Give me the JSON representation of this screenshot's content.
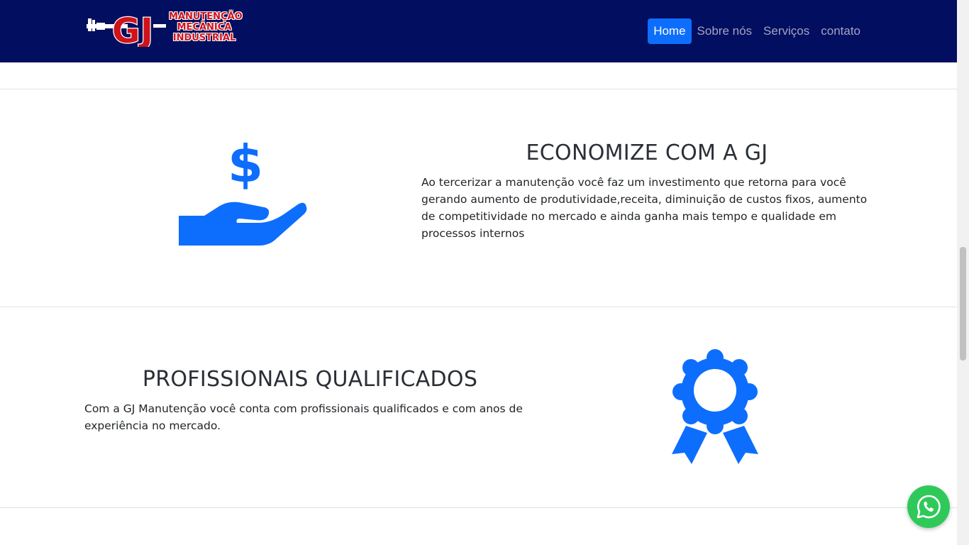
{
  "navbar": {
    "logo": {
      "initials": "GJ",
      "line1": "MANUTENÇÃO",
      "line2": "MECÂNICA",
      "line3": "INDUSTRIAL"
    },
    "links": [
      {
        "label": "Home",
        "active": true
      },
      {
        "label": "Sobre nós",
        "active": false
      },
      {
        "label": "Serviços",
        "active": false
      },
      {
        "label": "contato",
        "active": false
      }
    ]
  },
  "section_economize": {
    "title": "ECONOMIZE COM A GJ",
    "text": "Ao tercerizar a manutenção você faz um investimento que retorna para você gerando aumento de produtividade,receita, diminuição de custos fixos, aumento de competitividade no mercado e ainda ganha mais tempo e qualidade em processos internos",
    "icon": "money-hand-icon"
  },
  "section_profissionais": {
    "title": "PROFISSIONAIS QUALIFICADOS",
    "text": "Com a GJ Manutenção você conta com profissionais qualificados e com anos de experiência no mercado.",
    "icon": "award-ribbon-icon"
  },
  "colors": {
    "navbar_bg": "#020e5f",
    "accent": "#0d6efd",
    "whatsapp": "#2fc95a",
    "logo_red": "#d0121b"
  }
}
